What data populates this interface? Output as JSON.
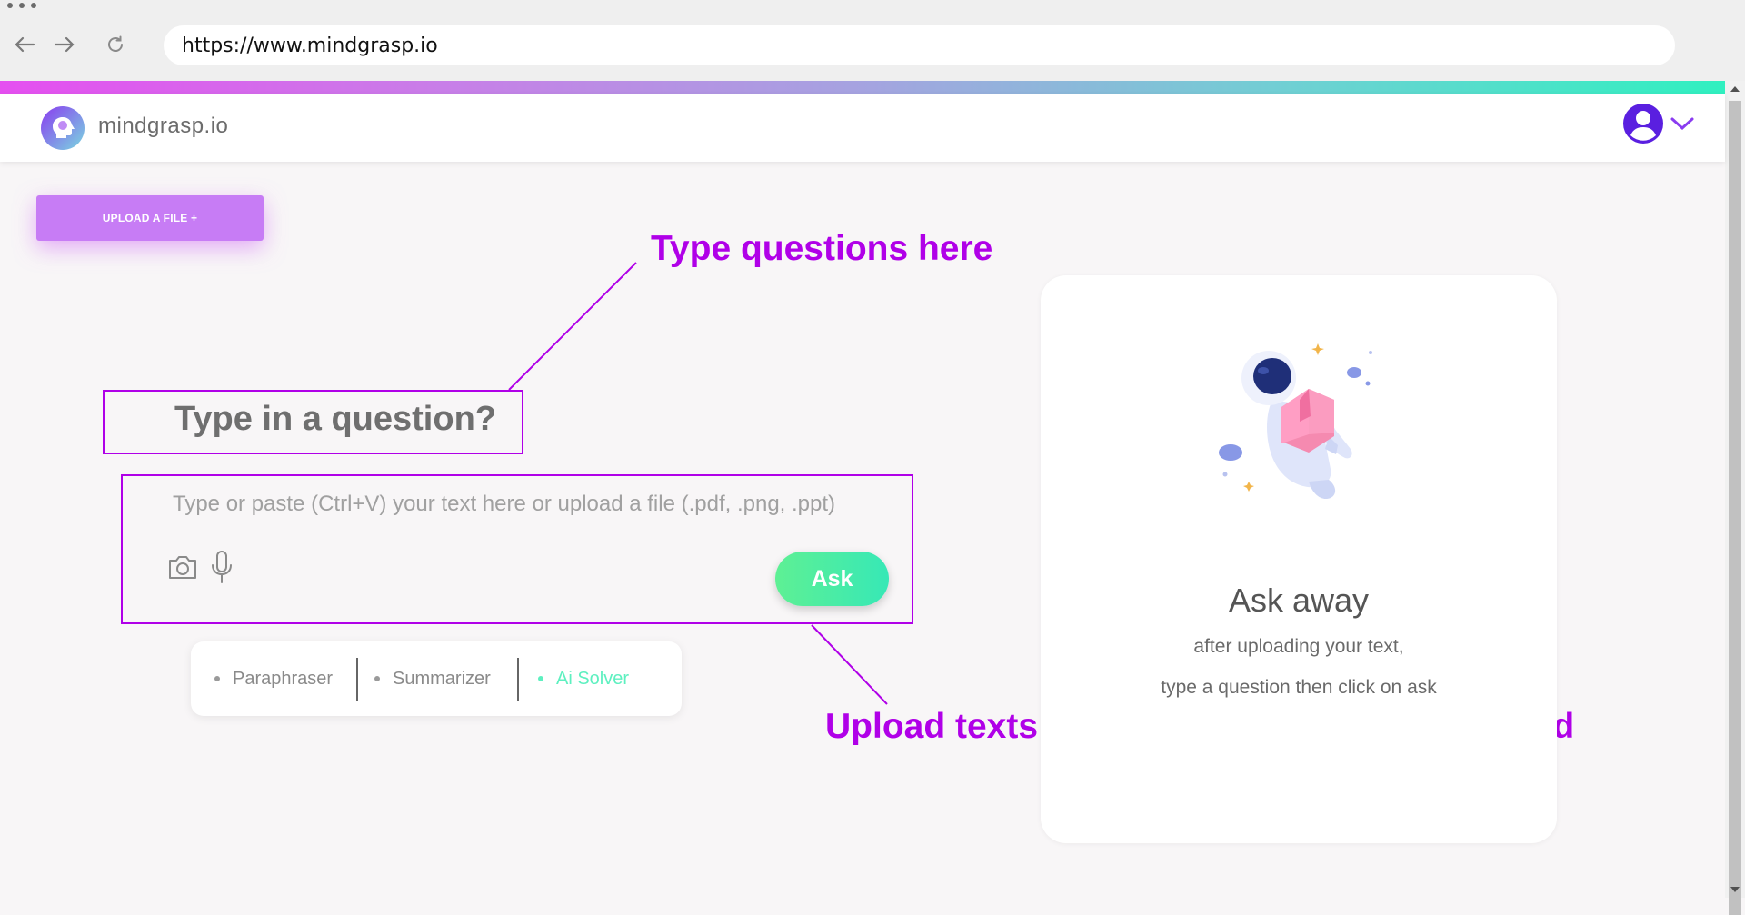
{
  "browser": {
    "url": "https://www.mindgrasp.io"
  },
  "header": {
    "brand": "mindgrasp.io"
  },
  "upload": {
    "label": "UPLOAD A FILE +"
  },
  "question": {
    "heading": "Type in a question?",
    "placeholder": "Type or paste (Ctrl+V) your text here or upload a file (.pdf, .png, .ppt)",
    "ask_label": "Ask"
  },
  "modes": [
    {
      "label": "Paraphraser",
      "active": false
    },
    {
      "label": "Summarizer",
      "active": false
    },
    {
      "label": "Ai Solver",
      "active": true
    }
  ],
  "card": {
    "title": "Ask away",
    "line1": "after uploading your text,",
    "line2": "type a question then click on ask"
  },
  "annotations": {
    "top": "Type questions here",
    "bottom": "Upload texts you want the AI to analyze/read",
    "color": "#b000e8"
  },
  "colors": {
    "accent_purple": "#c77cf5",
    "accent_green": "#37e8b6",
    "user_icon": "#5a1fe0"
  }
}
